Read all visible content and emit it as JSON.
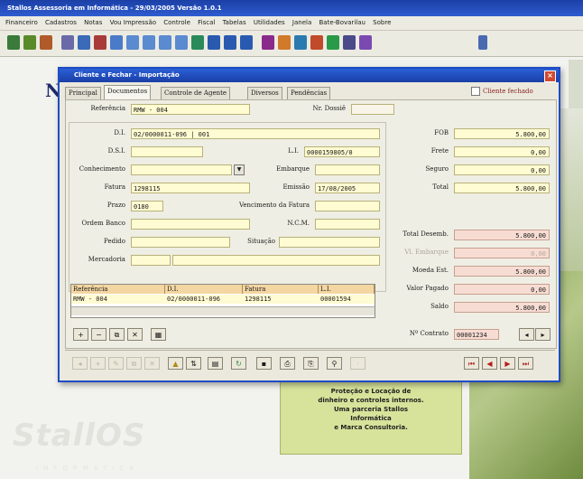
{
  "app": {
    "title": "Stallos Assessoria em Informática - 29/03/2005 Versão 1.0.1",
    "menu": [
      "Financeiro",
      "Cadastros",
      "Notas",
      "Vou Impressão",
      "Controle",
      "Fiscal",
      "Tabelas",
      "Utilidades",
      "Janela",
      "Bate-Bovarilau",
      "Sobre"
    ]
  },
  "background": {
    "letter": "N",
    "promo_text": [
      "Proteção e Locação de",
      "dinheiro e controles internos.",
      "Uma parceria Stallos",
      "Informática",
      "e Marca Consultoria."
    ],
    "logo": "StallOS",
    "logo_sub": "INFORMÁTICA"
  },
  "dialog": {
    "title": "Cliente e Fechar - Importação",
    "close_label": "×",
    "tabs": [
      "Principal",
      "Documentos",
      "Controle de Agente",
      "Diversos",
      "Pendências"
    ],
    "active_tab": 1,
    "closed_checkbox_label": "Cliente fechado",
    "referencia_label": "Referência",
    "referencia_value": "RMW - 004",
    "dossie_label": "Nr. Dossiê",
    "dossie_value": "",
    "di_label": "D.I.",
    "di_value": "02/0000011-096 | 001",
    "dsi_label": "D.S.I.",
    "dsi_value": "",
    "li_label": "L.I.",
    "li_value": "0000159805/0",
    "conhecimento_label": "Conhecimento",
    "conhecimento_value": "",
    "embarque_label": "Embarque",
    "embarque_value": "",
    "fatura_label": "Fatura",
    "fatura_value": "1298115",
    "emissao_label": "Emissão",
    "emissao_value": "17/08/2005",
    "prazo_label": "Prazo",
    "prazo_value": "0180",
    "vencimento_label": "Vencimento da Fatura",
    "vencimento_value": "",
    "ordem_label": "Ordem Banco",
    "ordem_value": "",
    "ncm_label": "N.C.M.",
    "ncm_value": "",
    "pedido_label": "Pedido",
    "pedido_value": "",
    "situacao_label": "Situação",
    "situacao_value": "",
    "mercadoria_label": "Mercadoria",
    "mercadoria_value": "",
    "totals": {
      "fob_label": "FOB",
      "fob_value": "5.800,00",
      "frete_label": "Frete",
      "frete_value": "0,00",
      "seguro_label": "Seguro",
      "seguro_value": "0,00",
      "total_label": "Total",
      "total_value": "5.800,00",
      "total_desemb_label": "Total Desemb.",
      "total_desemb_value": "5.800,00",
      "vl_embarque_label": "Vl. Embarque",
      "vl_embarque_value": "0,00",
      "moeda_est_label": "Moeda Est.",
      "moeda_est_value": "5.800,00",
      "valor_pago_label": "Valor Pagado",
      "valor_pago_value": "0,00",
      "saldo_label": "Saldo",
      "saldo_value": "5.800,00",
      "contrato_label": "Nº Contrato",
      "contrato_value": "00001234"
    },
    "grid": {
      "headers": [
        "Referência",
        "D.I.",
        "Fatura",
        "L.I."
      ],
      "rows": [
        [
          "RMW - 004",
          "02/0000011-096",
          "1298115",
          "00001594"
        ]
      ]
    }
  },
  "colors": {
    "titlebar": "#1b3fa6",
    "field_yellow": "#fffbd2",
    "field_pink": "#f7dcd3",
    "promo_green": "#d7e39a"
  }
}
